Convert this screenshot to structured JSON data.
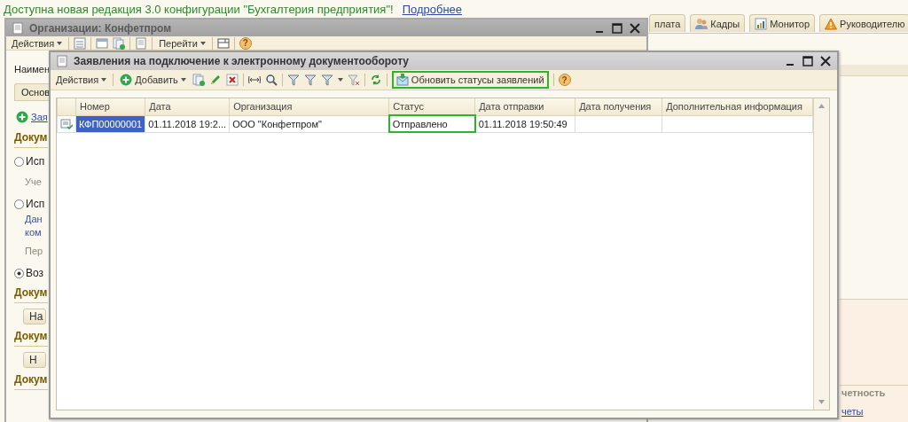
{
  "banner": {
    "text": "Доступна новая редакция 3.0 конфигурации \"Бухгалтерия предприятия\"!",
    "link": "Подробнее"
  },
  "main_tabs": [
    {
      "label": "плата",
      "selected": false
    },
    {
      "label": "Кадры",
      "selected": false
    },
    {
      "label": "Монитор",
      "selected": false
    },
    {
      "label": "Руководителю",
      "selected": false
    }
  ],
  "background_panel": {
    "heading": "четность",
    "link": "четы"
  },
  "org_window": {
    "title": "Организации: Конфетпром",
    "toolbar": {
      "actions_menu": "Действия",
      "goto_menu": "Перейти",
      "help_button": "?"
    },
    "content": [
      {
        "kind": "label",
        "text": "Наимен"
      },
      {
        "kind": "tab",
        "text": "Основ"
      },
      {
        "kind": "add_link",
        "text": "Зая"
      },
      {
        "kind": "heading",
        "text": "Докум"
      },
      {
        "kind": "radio",
        "text": "Исп",
        "checked": false
      },
      {
        "kind": "note",
        "text": "Уче"
      },
      {
        "kind": "radio",
        "text": "Исп",
        "checked": false
      },
      {
        "kind": "blue_note",
        "text": "Дан"
      },
      {
        "kind": "blue_note",
        "text": "ком"
      },
      {
        "kind": "note",
        "text": "Пер"
      },
      {
        "kind": "radio",
        "text": "Воз",
        "checked": true
      },
      {
        "kind": "heading",
        "text": "Докум"
      },
      {
        "kind": "button",
        "text": "На"
      },
      {
        "kind": "heading",
        "text": "Докум"
      },
      {
        "kind": "button",
        "text": "Н"
      },
      {
        "kind": "heading",
        "text": "Докум"
      }
    ]
  },
  "applications_window": {
    "title": "Заявления на подключение к электронному документообороту",
    "toolbar": {
      "actions_menu": "Действия",
      "add_button": "Добавить",
      "update_button": {
        "label": "Обновить статусы заявлений",
        "highlighted": true
      },
      "help_button": "?"
    },
    "table": {
      "columns": [
        "Номер",
        "Дата",
        "Организация",
        "Статус",
        "Дата отправки",
        "Дата получения",
        "Дополнительная информация"
      ],
      "rows": [
        {
          "cells": [
            {
              "text": "КФП00000001",
              "selected": true,
              "highlighted": false
            },
            {
              "text": "01.11.2018 19:2...",
              "selected": false,
              "highlighted": false
            },
            {
              "text": "ООО \"Конфетпром\"",
              "selected": false,
              "highlighted": false
            },
            {
              "text": "Отправлено",
              "selected": false,
              "highlighted": true
            },
            {
              "text": "01.11.2018 19:50:49",
              "selected": false,
              "highlighted": false
            },
            {
              "selected": false,
              "highlighted": false
            },
            {
              "selected": false,
              "highlighted": false
            }
          ]
        }
      ]
    }
  }
}
